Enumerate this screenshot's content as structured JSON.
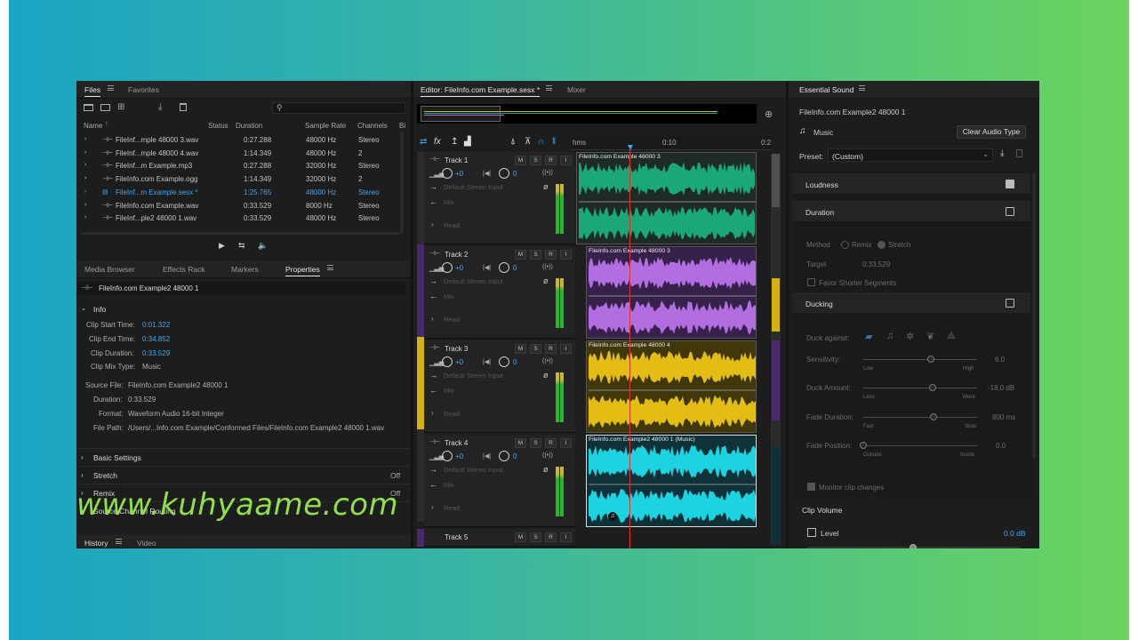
{
  "files_panel": {
    "tabs": [
      "Files",
      "Favorites"
    ],
    "search_placeholder": "",
    "columns": [
      "Name",
      "Status",
      "Duration",
      "Sample Rate",
      "Channels",
      "Bi"
    ],
    "rows": [
      {
        "name": "FileInf...mple 48000 3.wav",
        "duration": "0:27.288",
        "rate": "48000 Hz",
        "channels": "Stereo"
      },
      {
        "name": "FileInf...mple 48000 4.wav",
        "duration": "1:14.349",
        "rate": "48000 Hz",
        "channels": "2"
      },
      {
        "name": "FileInf...m Example.mp3",
        "duration": "0:27.288",
        "rate": "32000 Hz",
        "channels": "Stereo"
      },
      {
        "name": "FileInfo.com Example.ogg",
        "duration": "1:14.349",
        "rate": "32000 Hz",
        "channels": "2"
      },
      {
        "name": "FileInf...m Example.sesx *",
        "duration": "1:25.765",
        "rate": "48000 Hz",
        "channels": "Stereo"
      },
      {
        "name": "FileInfo.com Example.wav",
        "duration": "0:33.529",
        "rate": "8000 Hz",
        "channels": "Stereo"
      },
      {
        "name": "FileInf...ple2 48000 1.wav",
        "duration": "0:33.529",
        "rate": "48000 Hz",
        "channels": "Stereo"
      }
    ]
  },
  "props_panel": {
    "tabs": [
      "Media Browser",
      "Effects Rack",
      "Markers",
      "Properties"
    ],
    "clip_name": "FileInfo.com Example2 48000 1",
    "info_label": "Info",
    "clip_start_label": "Clip Start Time:",
    "clip_start": "0:01.322",
    "clip_end_label": "Clip End Time:",
    "clip_end": "0:34.852",
    "clip_duration_label": "Clip Duration:",
    "clip_duration": "0:33.529",
    "clip_mix_label": "Clip Mix Type:",
    "clip_mix": "Music",
    "source_label": "Source File:",
    "source": "FileInfo.com Example2 48000 1",
    "duration_label": "Duration:",
    "duration": "0:33.529",
    "format_label": "Format:",
    "format": "Waveform Audio 16-bit Integer",
    "path_label": "File Path:",
    "path": "/Users/...Info.com Example/Conformed Files/FileInfo.com Example2 48000 1.wav",
    "sections": [
      {
        "label": "Basic Settings",
        "value": ""
      },
      {
        "label": "Stretch",
        "value": "Off"
      },
      {
        "label": "Remix",
        "value": "Off"
      },
      {
        "label": "Source Channel Routing",
        "value": ""
      }
    ],
    "bottom_tabs": [
      "History",
      "Video"
    ]
  },
  "editor": {
    "tabs": [
      "Editor: FileInfo.com Example.sesx *",
      "Mixer"
    ],
    "ruler": [
      "hms",
      "0:10",
      "0:2"
    ],
    "tracks": [
      {
        "name": "Track 1",
        "vol": "+0",
        "pan": "0",
        "input": "Default Stereo Input",
        "bus": "Mix",
        "read": "Read",
        "clip": "FileInfo.com Example 48000 3",
        "color": "#1ba879",
        "bg": "#1e2a24",
        "side": "#2b2b2b"
      },
      {
        "name": "Track 2",
        "vol": "+0",
        "pan": "0",
        "input": "Default Stereo Input",
        "bus": "Mix",
        "read": "Read",
        "clip": "FileInfo.com Example 48000 3",
        "color": "#b26ee0",
        "bg": "#35214a",
        "side": "#4a2a6a"
      },
      {
        "name": "Track 3",
        "vol": "+0",
        "pan": "0",
        "input": "Default Stereo Input",
        "bus": "Mix",
        "read": "Read",
        "clip": "FileInfo.com Example 48000 4",
        "color": "#e3bd14",
        "bg": "#40380a",
        "side": "#d4b012"
      },
      {
        "name": "Track 4",
        "vol": "+0",
        "pan": "0",
        "input": "Default Stereo Input",
        "bus": "Mix",
        "read": "Read",
        "clip": "FileInfo.com Example2 48000 1 (Music)",
        "color": "#1cd3e2",
        "bg": "#0e3238",
        "side": "#2b2b2b"
      }
    ],
    "track5": "Track 5",
    "btn_m": "M",
    "btn_s": "S",
    "btn_r": "R",
    "btn_i": "I"
  },
  "essential": {
    "title": "Essential Sound",
    "clip_name": "FileInfo.com Example2 48000 1",
    "type": "Music",
    "clear_label": "Clear Audio Type",
    "preset_label": "Preset:",
    "preset": "(Custom)",
    "loudness": "Loudness",
    "duration": "Duration",
    "method_label": "Method",
    "remix": "Remix",
    "stretch": "Stretch",
    "target_label": "Target",
    "target": "0:33.529",
    "favor": "Favor Shorter Segments",
    "ducking": "Ducking",
    "duck_against": "Duck against:",
    "sensitivity_label": "Sensitivity:",
    "sensitivity": "6.0",
    "low": "Low",
    "high": "High",
    "duck_amount_label": "Duck Amount:",
    "duck_amount": "-18.0 dB",
    "less": "Less",
    "more": "More",
    "fade_duration_label": "Fade Duration:",
    "fade_duration": "800 ms",
    "fast": "Fast",
    "slow": "Slow",
    "fade_position_label": "Fade Position:",
    "fade_position": "0.0",
    "outside": "Outside",
    "inside": "Inside",
    "monitor": "Monitor clip changes",
    "clip_volume": "Clip Volume",
    "level_label": "Level",
    "level": "0.0 dB",
    "level_fraction": 0.5
  },
  "watermark": "www.kuhyaame.com"
}
